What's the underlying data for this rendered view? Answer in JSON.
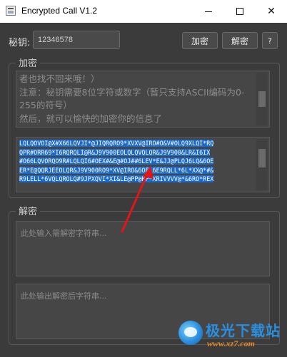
{
  "window": {
    "title": "Encrypted Call V1.2",
    "controls": {
      "minimize": "minimize",
      "maximize": "maximize",
      "close": "✕"
    }
  },
  "toolbar": {
    "key_label": "秘钥:",
    "key_value": "12346578",
    "encrypt_label": "加密",
    "decrypt_label": "解密",
    "help_label": "?"
  },
  "encrypt_group": {
    "title": "加密",
    "plain_text": "者也找不回来哦！）\n注意：秘钥需要8位字符或数字（暂只支持ASCII编码为0-255的符号）\n然后，就可以愉快的加密你的信息了",
    "cipher_lines": [
      "LQLQOVOI@X#X66LQVJI*@JIQRQRO9*XVXV@IRO#O&V#OLQ9XLQI*RQ",
      "QPR#ORR69*I6RQRQLI@R&J9V900EOLQLQVQLQR&J9V900&LR&I6IX",
      "#O66LQVORQO9R#LQLQI6#OEX#&E@#OJ##6LEV*E&JJ@PLQJ6LQ&6OE",
      "ER*E@QQRJEEOLQR&J9V900RO9*XV@IRO&6OEL6E9RQLL*6L*XX@*#&",
      "R9LELL*6VQLQROLQ#9JPXQVI*XI&LE@PP@RP*XRIVVVV@*&6RO*REX"
    ]
  },
  "decrypt_group": {
    "title": "解密",
    "input_placeholder": "此处输入需解密字符串...",
    "output_placeholder": "此处输出解密后字符串..."
  },
  "watermark": {
    "brand": "极光下载站",
    "url": "www.xz7.com"
  },
  "colors": {
    "background": "#3b3b3b",
    "selection": "#1b6ac9",
    "arrow": "#e0161b"
  },
  "icons": {
    "app": "lock-app-icon",
    "arrow": "red-arrow-annotation"
  }
}
